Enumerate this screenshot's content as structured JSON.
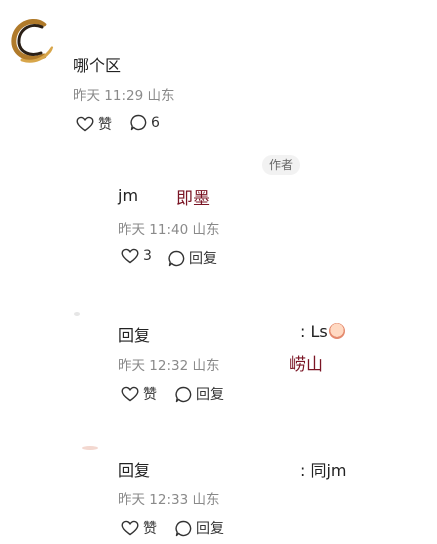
{
  "comments": [
    {
      "name": "哪个区",
      "meta": "昨天 11:29 山东",
      "like_label": "赞",
      "reply_count": "6"
    },
    {
      "author_tag": "作者",
      "name": "jm",
      "handwritten": "即墨",
      "meta": "昨天 11:40 山东",
      "like_count": "3",
      "reply_label": "回复"
    },
    {
      "name": "回复",
      "reply_text": ": Ls",
      "handwritten": "崂山",
      "meta": "昨天 12:32 山东",
      "like_label": "赞",
      "reply_label": "回复"
    },
    {
      "name": "回复",
      "reply_text": ": 同jm",
      "meta": "昨天 12:33 山东",
      "like_label": "赞",
      "reply_label": "回复"
    }
  ],
  "colors": {
    "meta": "#8a8a8a",
    "handwritten": "#7a1424",
    "author_tag_bg": "#f2f2f2"
  },
  "icons": [
    "heart-outline-icon",
    "speech-bubble-icon",
    "face-emoji-icon"
  ]
}
